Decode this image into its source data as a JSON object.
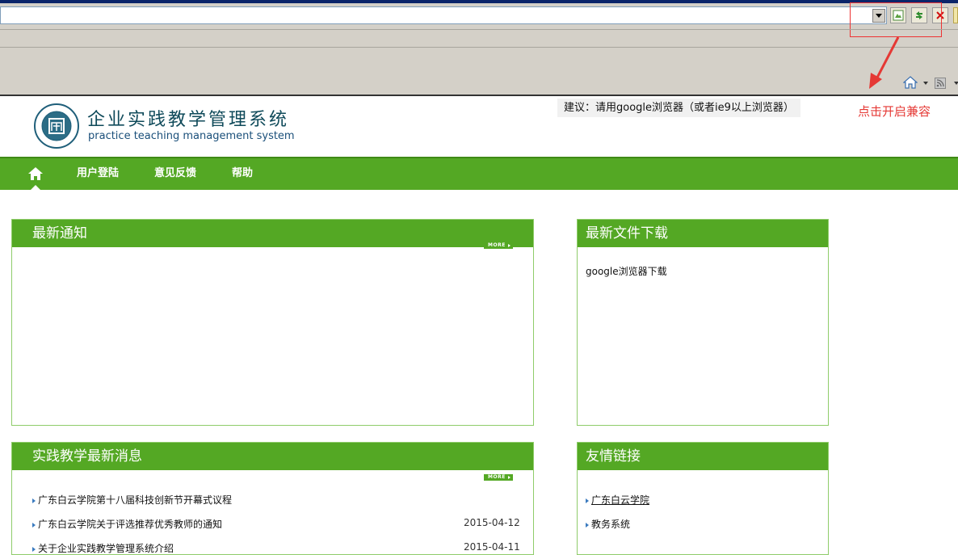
{
  "browser": {
    "icons": {
      "compat": "compatibility-view-icon",
      "refresh": "refresh-icon",
      "stop": "stop-icon",
      "home": "home-icon",
      "feeds": "rss-feed-icon"
    },
    "annotation": "点击开启兼容"
  },
  "header": {
    "title_cn": "企业实践教学管理系统",
    "title_en": "practice teaching management system",
    "advice": "建议：请用google浏览器（或者ie9以上浏览器）"
  },
  "nav": {
    "items": [
      "用户登陆",
      "意见反馈",
      "帮助"
    ]
  },
  "panels": {
    "notices": {
      "title": "最新通知",
      "more": "MORE"
    },
    "downloads": {
      "title": "最新文件下载",
      "items": [
        "google浏览器下载"
      ]
    },
    "news": {
      "title": "实践教学最新消息",
      "more": "MORE",
      "rows": [
        {
          "title": "广东白云学院第十八届科技创新节开幕式议程",
          "date": ""
        },
        {
          "title": "广东白云学院关于评选推荐优秀教师的通知",
          "date": "2015-04-12"
        },
        {
          "title": "关于企业实践教学管理系统介绍",
          "date": "2015-04-11"
        }
      ]
    },
    "links": {
      "title": "友情链接",
      "items": [
        "广东白云学院",
        "教务系统"
      ]
    }
  },
  "colors": {
    "nav_green": "#54a824",
    "annotation_red": "#e53935"
  }
}
